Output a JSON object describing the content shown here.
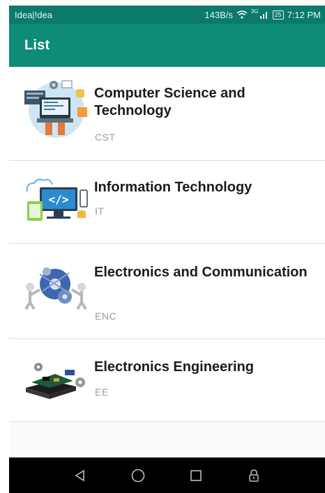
{
  "status_bar": {
    "carrier": "Idea|!dea",
    "net_speed": "143B/s",
    "network_type": "3G",
    "battery": "25",
    "time": "7:12 PM",
    "icons": [
      "wifi-icon",
      "signal-icon",
      "battery-icon"
    ]
  },
  "app_bar": {
    "title": "List"
  },
  "list": {
    "items": [
      {
        "title": "Computer Science and Technology",
        "code": "CST",
        "icon": "computer-science-illustration"
      },
      {
        "title": "Information Technology",
        "code": "IT",
        "icon": "information-technology-illustration"
      },
      {
        "title": "Electronics and Communication",
        "code": "ENC",
        "icon": "communication-gears-illustration"
      },
      {
        "title": "Electronics Engineering",
        "code": "EE",
        "icon": "circuit-board-illustration"
      }
    ]
  },
  "nav_bar": {
    "icons": [
      "back-icon",
      "home-icon",
      "recents-icon",
      "lock-icon"
    ]
  },
  "colors": {
    "status_bar": "#0b7a6c",
    "app_bar": "#0f8b7a",
    "nav_bar": "#000000",
    "code_text": "#9a9a9a"
  }
}
